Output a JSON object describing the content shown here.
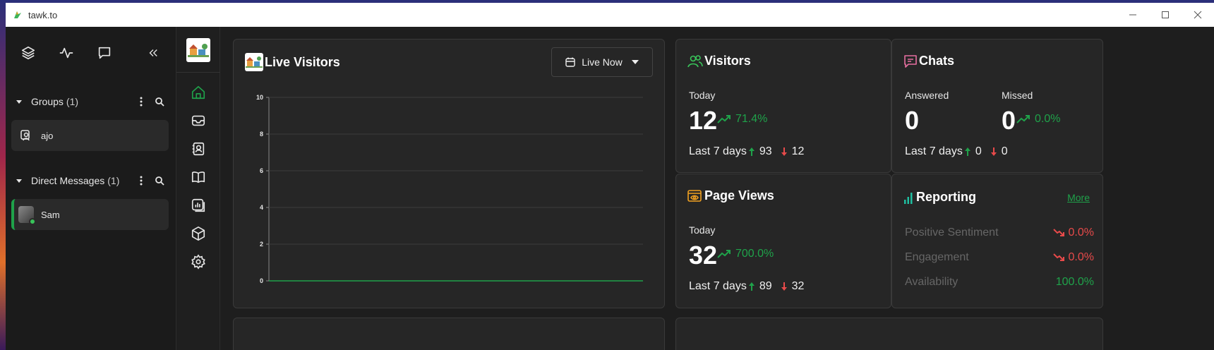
{
  "window": {
    "title": "tawk.to"
  },
  "sidebar": {
    "groups": {
      "label": "Groups",
      "count": "(1)",
      "items": [
        {
          "label": "ajo"
        }
      ]
    },
    "direct": {
      "label": "Direct Messages",
      "count": "(1)",
      "items": [
        {
          "label": "Sam"
        }
      ]
    }
  },
  "live_visitors": {
    "title": "Live Visitors",
    "select_value": "Live Now"
  },
  "visitors": {
    "title": "Visitors",
    "today_label": "Today",
    "today_value": "12",
    "trend": "71.4%",
    "last7_label": "Last 7 days",
    "last7_up": "93",
    "last7_down": "12"
  },
  "chats": {
    "title": "Chats",
    "answered_label": "Answered",
    "answered_value": "0",
    "missed_label": "Missed",
    "missed_value": "0",
    "trend": "0.0%",
    "last7_label": "Last 7 days",
    "last7_up": "0",
    "last7_down": "0"
  },
  "page_views": {
    "title": "Page Views",
    "today_label": "Today",
    "today_value": "32",
    "trend": "700.0%",
    "last7_label": "Last 7 days",
    "last7_up": "89",
    "last7_down": "32"
  },
  "reporting": {
    "title": "Reporting",
    "more": "More",
    "rows": [
      {
        "label": "Positive Sentiment",
        "value": "0.0%",
        "trend": "down"
      },
      {
        "label": "Engagement",
        "value": "0.0%",
        "trend": "down"
      },
      {
        "label": "Availability",
        "value": "100.0%",
        "trend": "none"
      }
    ]
  },
  "colors": {
    "accent": "#1fa24a",
    "negative": "#e84a4a",
    "visitors_icon": "#39c45a",
    "chats_icon": "#e66fa0",
    "pageviews_icon": "#f0a020",
    "reporting_icon": "#1fbfa0"
  },
  "chart_data": {
    "type": "line",
    "x": [
      0,
      1,
      2,
      3,
      4,
      5,
      6,
      7,
      8,
      9,
      10
    ],
    "series": [
      {
        "values": [
          0,
          0,
          0,
          0,
          0,
          0,
          0,
          0,
          0,
          0,
          0
        ]
      }
    ],
    "ylim": [
      0,
      10
    ],
    "yticks": [
      "0",
      "2",
      "4",
      "6",
      "8",
      "10"
    ],
    "grid": true
  }
}
